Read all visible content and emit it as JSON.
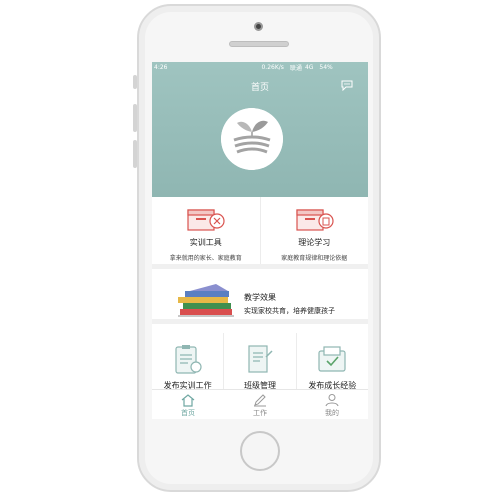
{
  "status_bar": {
    "time": "4:26",
    "speed": "0.26K/s",
    "carrier": "联通",
    "network": "4G",
    "battery": "54%"
  },
  "header": {
    "title": "首页",
    "chat_icon": "chat-bubble-icon",
    "logo_icon": "leaf-book-logo"
  },
  "cards": [
    {
      "title": "实训工具",
      "subtitle": "拿来就用的家长、家庭教育",
      "icon": "toolbox-icon"
    },
    {
      "title": "理论学习",
      "subtitle": "家庭教育规律和理论依据",
      "icon": "study-box-icon"
    }
  ],
  "effect": {
    "title": "教学效果",
    "subtitle": "实现家校共育，培养健康孩子",
    "icon": "books-stack-icon"
  },
  "tools": [
    {
      "label": "发布实训工作",
      "icon": "clipboard-edit-icon"
    },
    {
      "label": "班级管理",
      "icon": "document-pen-icon"
    },
    {
      "label": "发布成长经验",
      "icon": "tray-check-icon"
    }
  ],
  "tabbar": [
    {
      "label": "首页",
      "icon": "home-icon",
      "active": true
    },
    {
      "label": "工作",
      "icon": "edit-icon",
      "active": false
    },
    {
      "label": "我的",
      "icon": "user-icon",
      "active": false
    }
  ],
  "colors": {
    "header_teal": "#9fc4c0",
    "accent_red": "#d9534f",
    "tab_active": "#6fa7a2"
  }
}
